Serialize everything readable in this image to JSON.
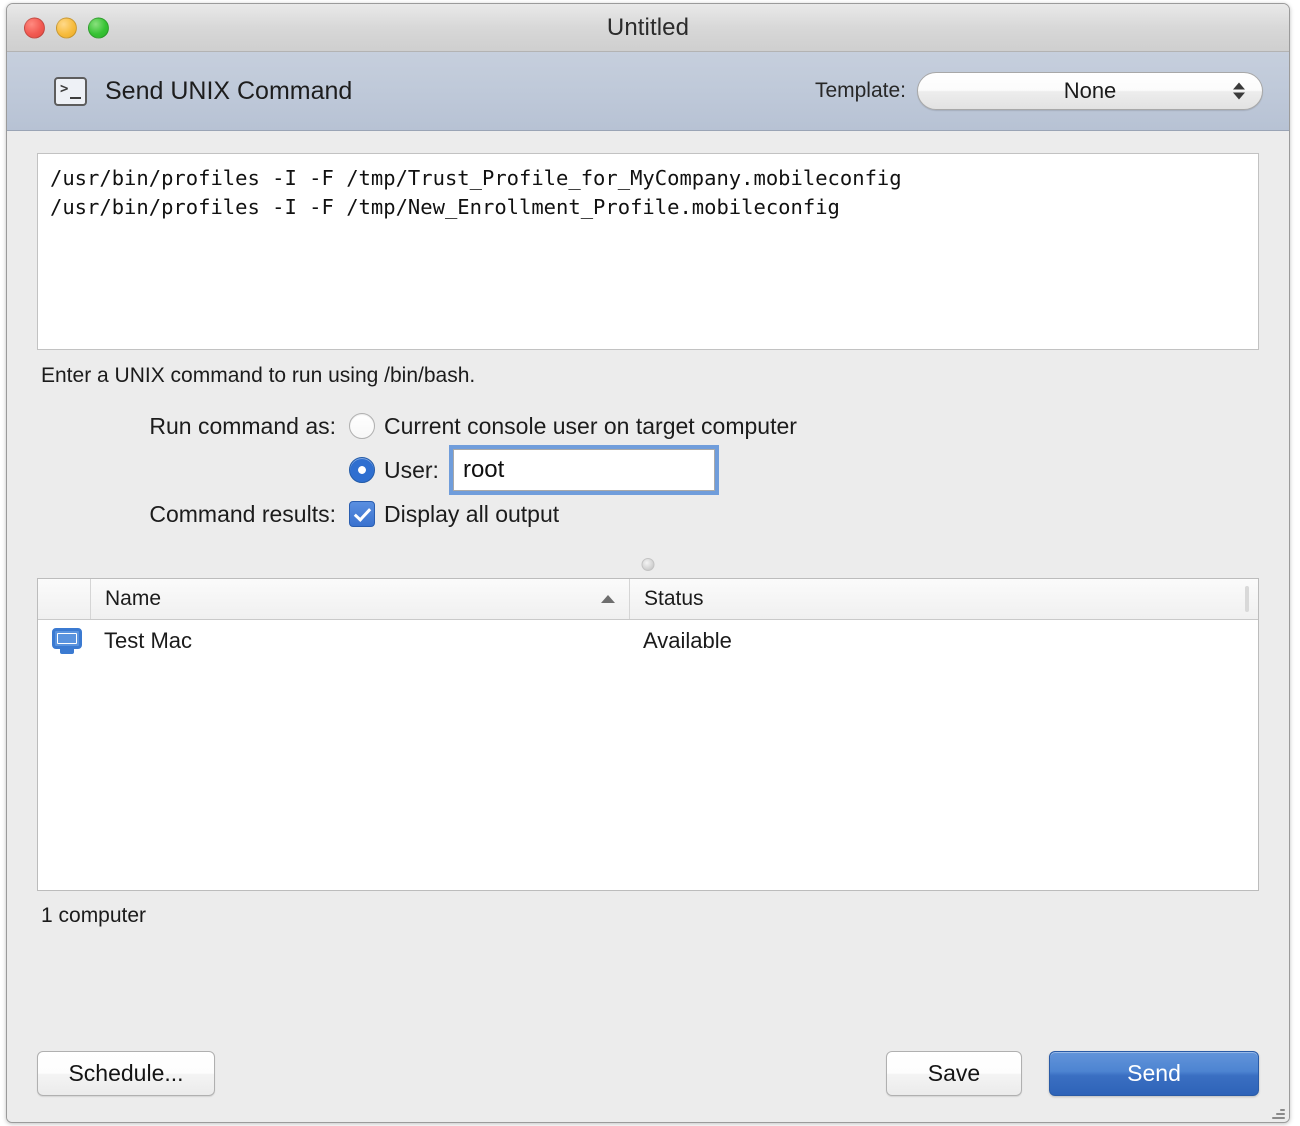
{
  "window": {
    "title": "Untitled",
    "traffic_lights": [
      "close",
      "minimize",
      "maximize"
    ]
  },
  "toolbar": {
    "icon": "terminal-icon",
    "prompt_glyph": ">",
    "title": "Send UNIX Command",
    "template_label": "Template:",
    "template_value": "None",
    "template_options": [
      "None"
    ]
  },
  "command": {
    "lines": [
      "/usr/bin/profiles -I -F /tmp/Trust_Profile_for_MyCompany.mobileconfig",
      "/usr/bin/profiles -I -F /tmp/New_Enrollment_Profile.mobileconfig"
    ],
    "hint": "Enter a UNIX command to run using /bin/bash."
  },
  "form": {
    "run_as_label": "Run command as:",
    "console_user_option": "Current console user on target computer",
    "console_user_selected": false,
    "user_option": "User:",
    "user_selected": true,
    "user_value": "root",
    "results_label": "Command results:",
    "display_all_output": "Display all output",
    "display_all_output_checked": true
  },
  "table": {
    "columns": [
      "Name",
      "Status"
    ],
    "sort_column": "Name",
    "sort_direction": "ascending",
    "rows": [
      {
        "icon": "computer-display-icon",
        "name": "Test Mac",
        "status": "Available"
      }
    ],
    "count_text": "1 computer"
  },
  "footer": {
    "schedule_label": "Schedule...",
    "save_label": "Save",
    "send_label": "Send"
  },
  "colors": {
    "accent_blue": "#3a72cf",
    "primary_button": "#2e63b8",
    "toolbar_bg": "#bfc9d9",
    "window_bg": "#ececec"
  }
}
